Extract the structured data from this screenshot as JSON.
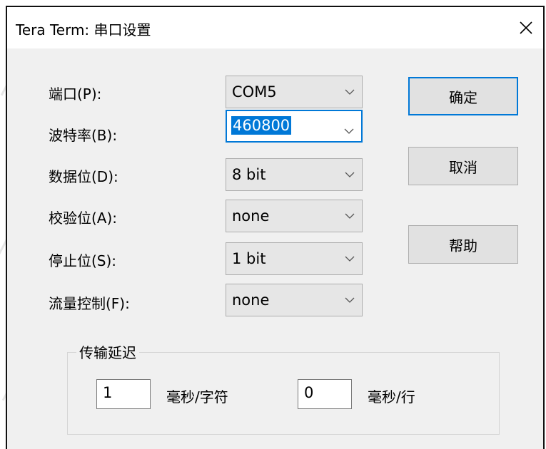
{
  "dialog": {
    "title": "Tera Term: 串口设置",
    "close_glyph": "✕"
  },
  "fields": [
    {
      "label": "端口(P):",
      "value": "COM5"
    },
    {
      "label": "波特率(B):",
      "value": "460800"
    },
    {
      "label": "数据位(D):",
      "value": "8 bit"
    },
    {
      "label": "校验位(A):",
      "value": "none"
    },
    {
      "label": "停止位(S):",
      "value": "1 bit"
    },
    {
      "label": "流量控制(F):",
      "value": "none"
    }
  ],
  "buttons": {
    "ok": "确定",
    "cancel": "取消",
    "help": "帮助"
  },
  "delay": {
    "title": "传输延迟",
    "char_value": "1",
    "char_unit": "毫秒/字符",
    "line_value": "0",
    "line_unit": "毫秒/行"
  },
  "colors": {
    "accent": "#0078d7",
    "dialog_bg": "#f0f0f0",
    "title_bg": "#ffffff"
  },
  "icons": [
    "close-icon",
    "chevron-down-icon"
  ]
}
